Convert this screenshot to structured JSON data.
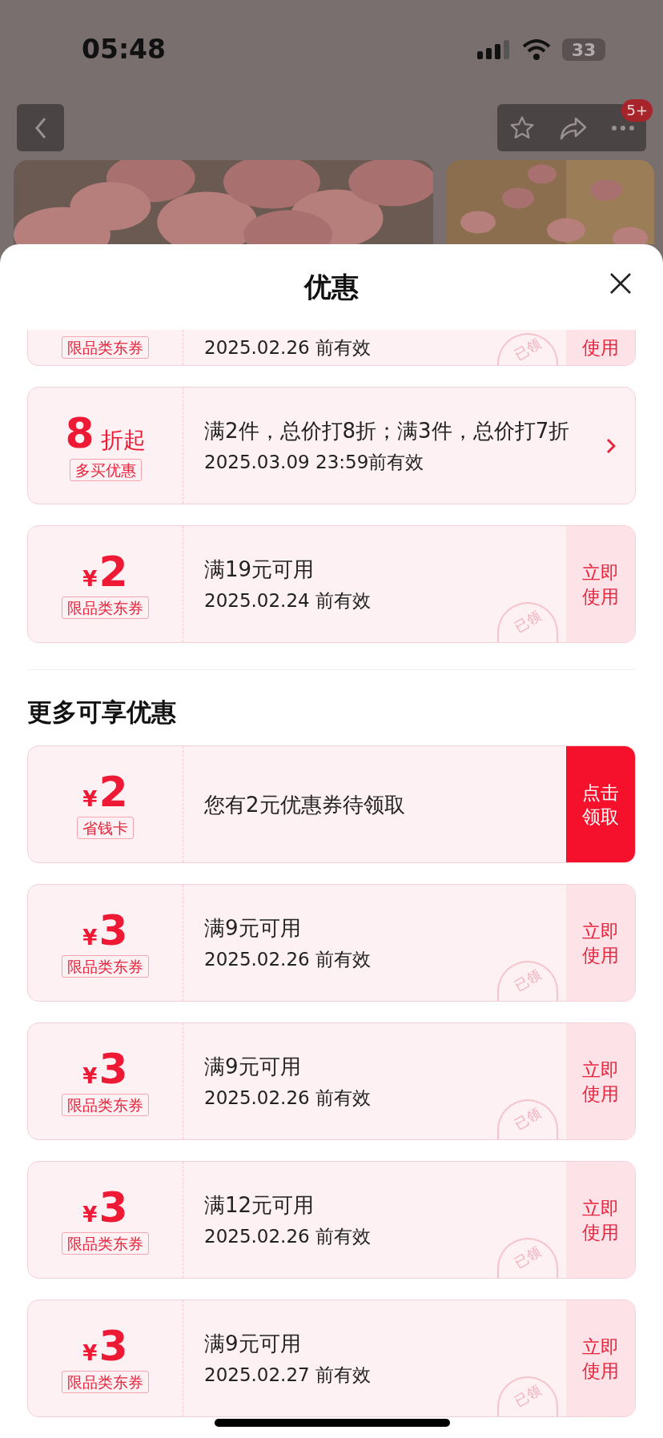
{
  "status_bar": {
    "time": "05:48",
    "battery": "33"
  },
  "nav": {
    "badge": "5+"
  },
  "sheet": {
    "title": "优惠",
    "coupons": [
      {
        "kind": "partial",
        "tag": "限品类东券",
        "expiry": "2025.02.26 前有效",
        "action": {
          "kind": "use",
          "label": "使用"
        },
        "stamp": "已领"
      },
      {
        "kind": "discount",
        "amount": "8",
        "unit": "折起",
        "tag": "多买优惠",
        "condition": "满2件，总价打8折；满3件，总价打7折",
        "expiry": "2025.03.09 23:59前有效",
        "action": {
          "kind": "detail"
        }
      },
      {
        "kind": "amount",
        "currency": "¥",
        "amount": "2",
        "tag": "限品类东券",
        "condition": "满19元可用",
        "expiry": "2025.02.24 前有效",
        "action": {
          "kind": "use",
          "label": "立即使用"
        },
        "stamp": "已领"
      }
    ],
    "more_section": {
      "heading": "更多可享优惠",
      "coupons": [
        {
          "kind": "amount",
          "currency": "¥",
          "amount": "2",
          "tag": "省钱卡",
          "condition": "您有2元优惠券待领取",
          "action": {
            "kind": "claim",
            "label": "点击领取"
          }
        },
        {
          "kind": "amount",
          "currency": "¥",
          "amount": "3",
          "tag": "限品类东券",
          "condition": "满9元可用",
          "expiry": "2025.02.26 前有效",
          "action": {
            "kind": "use",
            "label": "立即使用"
          },
          "stamp": "已领"
        },
        {
          "kind": "amount",
          "currency": "¥",
          "amount": "3",
          "tag": "限品类东券",
          "condition": "满9元可用",
          "expiry": "2025.02.26 前有效",
          "action": {
            "kind": "use",
            "label": "立即使用"
          },
          "stamp": "已领"
        },
        {
          "kind": "amount",
          "currency": "¥",
          "amount": "3",
          "tag": "限品类东券",
          "condition": "满12元可用",
          "expiry": "2025.02.26 前有效",
          "action": {
            "kind": "use",
            "label": "立即使用"
          },
          "stamp": "已领"
        },
        {
          "kind": "amount",
          "currency": "¥",
          "amount": "3",
          "tag": "限品类东券",
          "condition": "满9元可用",
          "expiry": "2025.02.27 前有效",
          "action": {
            "kind": "use",
            "label": "立即使用"
          },
          "stamp": "已领"
        }
      ]
    }
  }
}
